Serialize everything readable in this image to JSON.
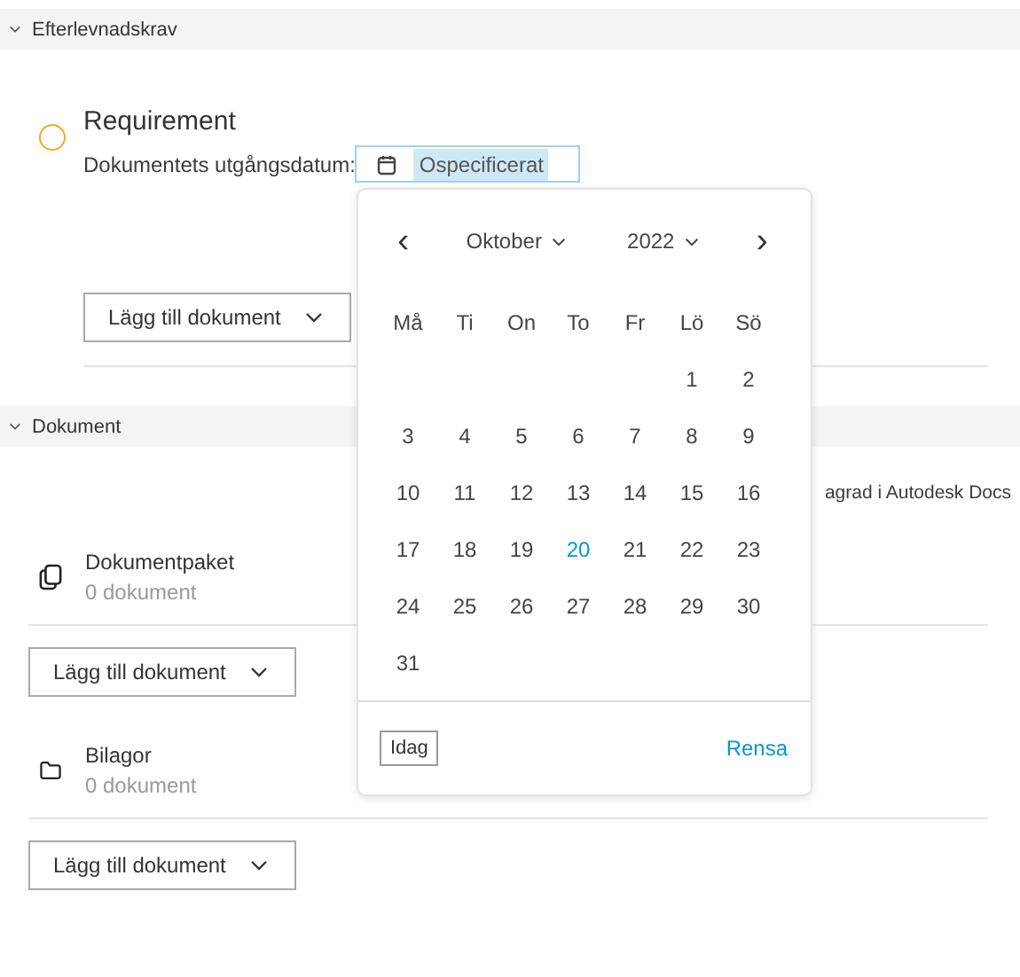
{
  "sections": [
    {
      "title": "Efterlevnadskrav",
      "expanded": true
    },
    {
      "title": "Dokument",
      "expanded": true
    }
  ],
  "requirement": {
    "title": "Requirement",
    "date_label": "Dokumentets utgångsdatum:",
    "date_value": "Ospecificerat",
    "add_button": "Lägg till dokument"
  },
  "storage_note": "agrad i Autodesk Docs",
  "folders": [
    {
      "kind": "package",
      "title": "Dokumentpaket",
      "count": "0 dokument",
      "add_button": "Lägg till dokument"
    },
    {
      "kind": "folder",
      "title": "Bilagor",
      "count": "0 dokument",
      "add_button": "Lägg till dokument"
    }
  ],
  "date_picker": {
    "prev": "‹",
    "month": "Oktober",
    "year": "2022",
    "next": "›",
    "weekdays": [
      "Må",
      "Ti",
      "On",
      "To",
      "Fr",
      "Lö",
      "Sö"
    ],
    "weeks": [
      {
        "days": [
          {
            "day": "1",
            "today": false
          },
          {
            "day": "2",
            "today": false
          }
        ]
      },
      {
        "days": [
          {
            "day": "3",
            "today": false
          },
          {
            "day": "4",
            "today": false
          },
          {
            "day": "5",
            "today": false
          },
          {
            "day": "6",
            "today": false
          },
          {
            "day": "7",
            "today": false
          },
          {
            "day": "8",
            "today": false
          },
          {
            "day": "9",
            "today": false
          }
        ]
      },
      {
        "days": [
          {
            "day": "10",
            "today": false
          },
          {
            "day": "11",
            "today": false
          },
          {
            "day": "12",
            "today": false
          },
          {
            "day": "13",
            "today": false
          },
          {
            "day": "14",
            "today": false
          },
          {
            "day": "15",
            "today": false
          },
          {
            "day": "16",
            "today": false
          }
        ]
      },
      {
        "days": [
          {
            "day": "17",
            "today": false
          },
          {
            "day": "18",
            "today": false
          },
          {
            "day": "19",
            "today": false
          },
          {
            "day": "20",
            "today": true
          },
          {
            "day": "21",
            "today": false
          },
          {
            "day": "22",
            "today": false
          },
          {
            "day": "23",
            "today": false
          }
        ]
      },
      {
        "days": [
          {
            "day": "24",
            "today": false
          },
          {
            "day": "25",
            "today": false
          },
          {
            "day": "26",
            "today": false
          },
          {
            "day": "27",
            "today": false
          },
          {
            "day": "28",
            "today": false
          },
          {
            "day": "29",
            "today": false
          },
          {
            "day": "30",
            "today": false
          }
        ]
      },
      {
        "days": [
          {
            "day": "31",
            "today": false
          }
        ]
      }
    ],
    "today_button": "Idag",
    "clear_link": "Rensa"
  }
}
